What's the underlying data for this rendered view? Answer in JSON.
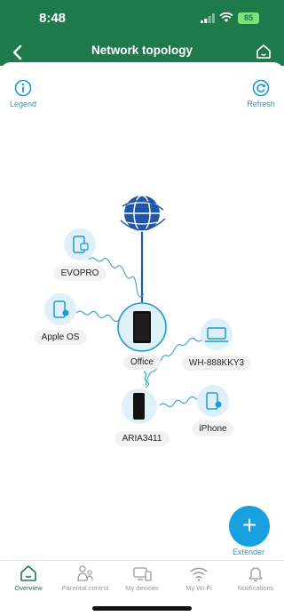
{
  "status": {
    "time": "8:48",
    "battery": "85"
  },
  "header": {
    "title": "Network topology"
  },
  "toolbar": {
    "legend_label": "Legend",
    "refresh_label": "Refresh"
  },
  "nodes": {
    "evopro": "EVOPRO",
    "apple_os": "Apple OS",
    "office": "Office",
    "wh": "WH-888KKY3",
    "aria": "ARIA3411",
    "iphone": "iPhone"
  },
  "fab": {
    "label": "Extender"
  },
  "tabs": [
    "Overview",
    "Parental control",
    "My devices",
    "My Wi-Fi",
    "Notifications"
  ],
  "colors": {
    "brand": "#1e7a4a",
    "accent": "#1a9bd4",
    "node_bg": "#d9eef8",
    "globe": "#1e56a8"
  }
}
